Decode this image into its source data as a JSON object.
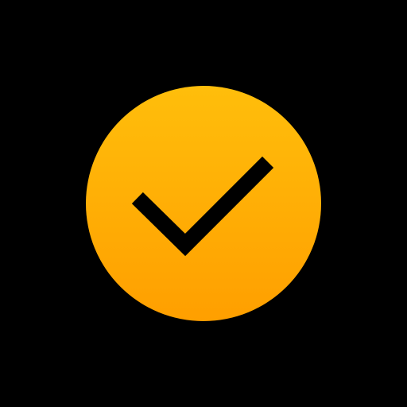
{
  "icon": {
    "name": "check-circle-icon",
    "background_color": "#000000",
    "circle_gradient_top": "#FFBE0B",
    "circle_gradient_bottom": "#FF9F00",
    "check_color": "#000000"
  }
}
